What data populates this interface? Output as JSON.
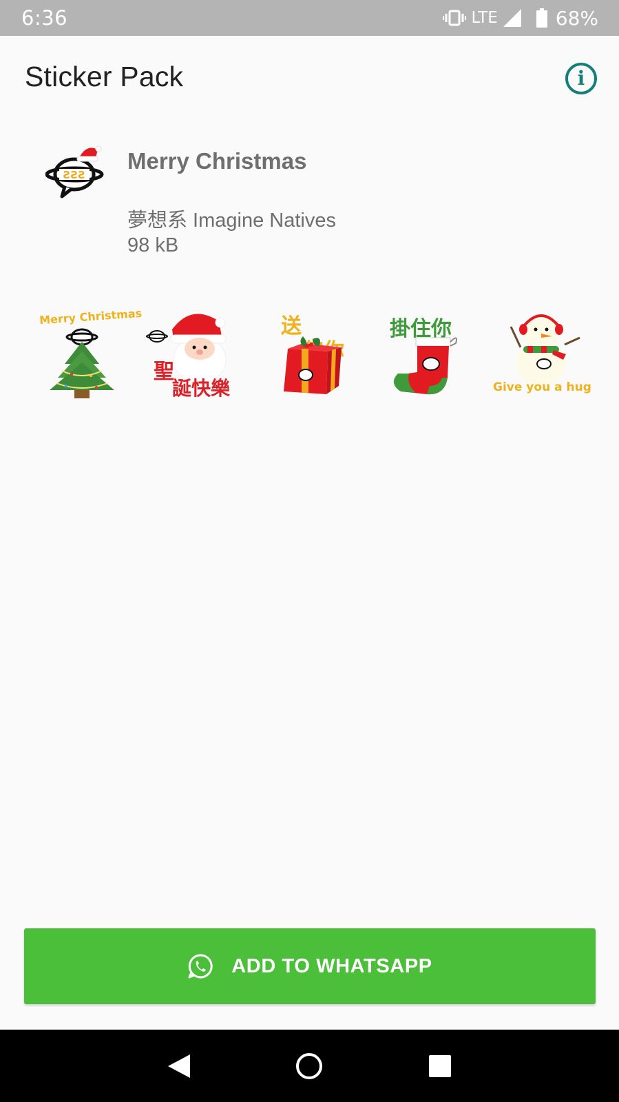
{
  "status_bar": {
    "time": "6:36",
    "network": "LTE",
    "battery": "68%"
  },
  "app_bar": {
    "title": "Sticker Pack",
    "info_icon": "info-icon"
  },
  "pack": {
    "name": "Merry Christmas",
    "publisher": "夢想系 Imagine Natives",
    "size": "98 kB"
  },
  "stickers": [
    {
      "name": "christmas-tree-sticker",
      "text": "Merry Christmas"
    },
    {
      "name": "santa-sticker",
      "text_lines": [
        "聖",
        "誕快樂"
      ]
    },
    {
      "name": "gift-sticker",
      "text_lines": [
        "送",
        "俾你"
      ]
    },
    {
      "name": "stocking-sticker",
      "text": "掛住你"
    },
    {
      "name": "snowman-sticker",
      "text": "Give you a hug"
    }
  ],
  "add_button": {
    "label": "ADD TO WHATSAPP",
    "icon": "whatsapp-icon"
  },
  "colors": {
    "accent": "#147f7a",
    "button_green": "#4bbf3a",
    "status_bar": "#b4b4b4"
  }
}
